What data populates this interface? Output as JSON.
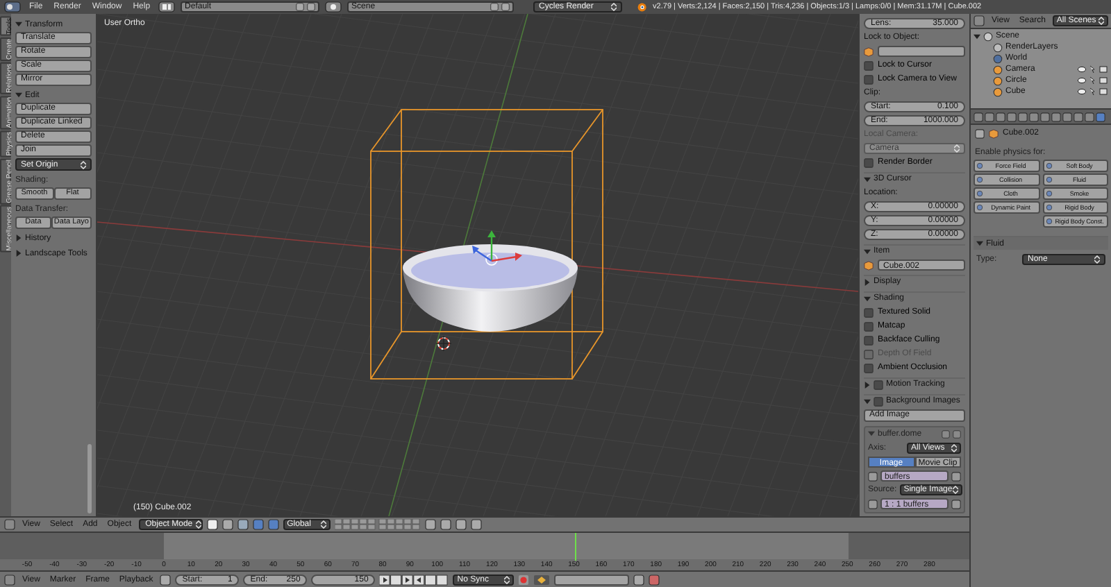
{
  "top_bar": {
    "menus": [
      "File",
      "Render",
      "Window",
      "Help"
    ],
    "layout": "Default",
    "scene": "Scene",
    "engine": "Cycles Render",
    "stats": "v2.79 | Verts:2,124 | Faces:2,150 | Tris:4,236 | Objects:1/3 | Lamps:0/0 | Mem:31.17M | Cube.002"
  },
  "tool_tabs": [
    {
      "label": "Tools",
      "selected": true
    },
    {
      "label": "Create",
      "selected": false
    },
    {
      "label": "Relations",
      "selected": false
    },
    {
      "label": "Animation",
      "selected": false
    },
    {
      "label": "Physics",
      "selected": false
    },
    {
      "label": "Grease Pencil",
      "selected": false
    },
    {
      "label": "Miscellaneous",
      "selected": false
    }
  ],
  "tool_shelf": [
    {
      "kind": "header",
      "label": "Transform",
      "expanded": true
    },
    {
      "kind": "button",
      "label": "Translate"
    },
    {
      "kind": "button",
      "label": "Rotate"
    },
    {
      "kind": "button",
      "label": "Scale"
    },
    {
      "kind": "button",
      "label": "Mirror"
    },
    {
      "kind": "header",
      "label": "Edit",
      "expanded": true
    },
    {
      "kind": "button",
      "label": "Duplicate"
    },
    {
      "kind": "button",
      "label": "Duplicate Linked"
    },
    {
      "kind": "button",
      "label": "Delete"
    },
    {
      "kind": "button",
      "label": "Join"
    },
    {
      "kind": "dropdown",
      "label": "Set Origin"
    },
    {
      "kind": "label",
      "label": "Shading:"
    },
    {
      "kind": "pair",
      "labels": [
        "Smooth",
        "Flat"
      ]
    },
    {
      "kind": "label",
      "label": "Data Transfer:"
    },
    {
      "kind": "pair",
      "labels": [
        "Data",
        "Data Layo"
      ]
    },
    {
      "kind": "header",
      "label": "History",
      "expanded": false
    },
    {
      "kind": "header",
      "label": "Landscape Tools",
      "expanded": false
    }
  ],
  "viewport": {
    "view_label": "User Ortho",
    "object_label": "(150) Cube.002"
  },
  "n_panel": [
    {
      "kind": "field",
      "label": "Lens:",
      "value": "35.000"
    },
    {
      "kind": "label",
      "label": "Lock to Object:",
      "disabled": false
    },
    {
      "kind": "object_field"
    },
    {
      "kind": "checkbox",
      "label": "Lock to Cursor",
      "checked": false,
      "disabled": false
    },
    {
      "kind": "checkbox",
      "label": "Lock Camera to View",
      "checked": false,
      "disabled": false
    },
    {
      "kind": "label",
      "label": "Clip:",
      "disabled": false
    },
    {
      "kind": "field",
      "label": "Start:",
      "value": "0.100"
    },
    {
      "kind": "field",
      "label": "End:",
      "value": "1000.000"
    },
    {
      "kind": "label",
      "label": "Local Camera:",
      "disabled": true
    },
    {
      "kind": "dropdown",
      "value": "Camera",
      "disabled": true
    },
    {
      "kind": "checkbox",
      "label": "Render Border",
      "checked": false,
      "disabled": false
    },
    {
      "kind": "header",
      "label": "3D Cursor",
      "expanded": true
    },
    {
      "kind": "label",
      "label": "Location:",
      "disabled": false
    },
    {
      "kind": "field",
      "label": "X:",
      "value": "0.00000"
    },
    {
      "kind": "field",
      "label": "Y:",
      "value": "0.00000"
    },
    {
      "kind": "field",
      "label": "Z:",
      "value": "0.00000"
    },
    {
      "kind": "header",
      "label": "Item",
      "expanded": true
    },
    {
      "kind": "object_field",
      "value": "Cube.002"
    },
    {
      "kind": "header",
      "label": "Display",
      "expanded": false
    },
    {
      "kind": "header",
      "label": "Shading",
      "expanded": true
    },
    {
      "kind": "checkbox",
      "label": "Textured Solid",
      "checked": false,
      "disabled": false
    },
    {
      "kind": "checkbox",
      "label": "Matcap",
      "checked": false,
      "disabled": false
    },
    {
      "kind": "checkbox",
      "label": "Backface Culling",
      "checked": false,
      "disabled": false
    },
    {
      "kind": "checkbox",
      "label": "Depth Of Field",
      "checked": false,
      "disabled": true
    },
    {
      "kind": "checkbox",
      "label": "Ambient Occlusion",
      "checked": false,
      "disabled": false
    },
    {
      "kind": "header",
      "label": "Motion Tracking",
      "expanded": false,
      "checked": false
    },
    {
      "kind": "header",
      "label": "Background Images",
      "expanded": true,
      "checked": false
    },
    {
      "kind": "button",
      "label": "Add Image"
    },
    {
      "kind": "image_box",
      "name": "buffer.dome",
      "rows": [
        {
          "kind": "select",
          "label": "Axis:",
          "value": "All Views"
        },
        {
          "kind": "toggle",
          "options": [
            {
              "label": "Image",
              "selected": true
            },
            {
              "label": "Movie Clip",
              "selected": false
            }
          ]
        },
        {
          "kind": "file",
          "value": "buffers"
        },
        {
          "kind": "select",
          "label": "Source:",
          "value": "Single Image"
        },
        {
          "kind": "file",
          "value": "1 : 1 buffers"
        }
      ]
    }
  ],
  "viewport_header": {
    "menus": [
      "View",
      "Select",
      "Add",
      "Object"
    ],
    "mode": "Object Mode",
    "orientation": "Global"
  },
  "timeline": {
    "ruler": [
      "-50",
      "-40",
      "-30",
      "-20",
      "-10",
      "0",
      "10",
      "20",
      "30",
      "40",
      "50",
      "60",
      "70",
      "80",
      "90",
      "100",
      "110",
      "120",
      "130",
      "140",
      "150",
      "160",
      "170",
      "180",
      "190",
      "200",
      "210",
      "220",
      "230",
      "240",
      "250",
      "260",
      "270",
      "280"
    ]
  },
  "timeline_footer": {
    "menus": [
      "View",
      "Marker",
      "Frame",
      "Playback"
    ],
    "start_label": "Start:",
    "start": "1",
    "end_label": "End:",
    "end": "250",
    "current": "150",
    "sync": "No Sync"
  },
  "outliner": {
    "menus": [
      "View",
      "Search"
    ],
    "display": "All Scenes",
    "tree": [
      {
        "kind": "scene",
        "label": "Scene",
        "expanded": true,
        "children": [
          {
            "kind": "layers",
            "label": "RenderLayers"
          },
          {
            "kind": "world",
            "label": "World"
          },
          {
            "kind": "object",
            "label": "Camera"
          },
          {
            "kind": "object",
            "label": "Circle"
          },
          {
            "kind": "object",
            "label": "Cube"
          }
        ]
      }
    ]
  },
  "properties": {
    "tabs": [
      {
        "selected": false
      },
      {
        "selected": false
      },
      {
        "selected": false
      },
      {
        "selected": false
      },
      {
        "selected": false
      },
      {
        "selected": false
      },
      {
        "selected": false
      },
      {
        "selected": false
      },
      {
        "selected": false
      },
      {
        "selected": false
      },
      {
        "selected": false
      },
      {
        "selected": true
      }
    ],
    "context": "Cube.002",
    "physics_label": "Enable physics for:",
    "physics": [
      {
        "left": "Force Field",
        "right": "Soft Body"
      },
      {
        "left": "Collision",
        "right": "Fluid"
      },
      {
        "left": "Cloth",
        "right": "Smoke"
      },
      {
        "left": "Dynamic Paint",
        "right": "Rigid Body"
      },
      {
        "right": "Rigid Body Const."
      }
    ],
    "fluid": {
      "label": "Fluid",
      "expanded": true,
      "type_label": "Type:",
      "type": "None"
    }
  }
}
